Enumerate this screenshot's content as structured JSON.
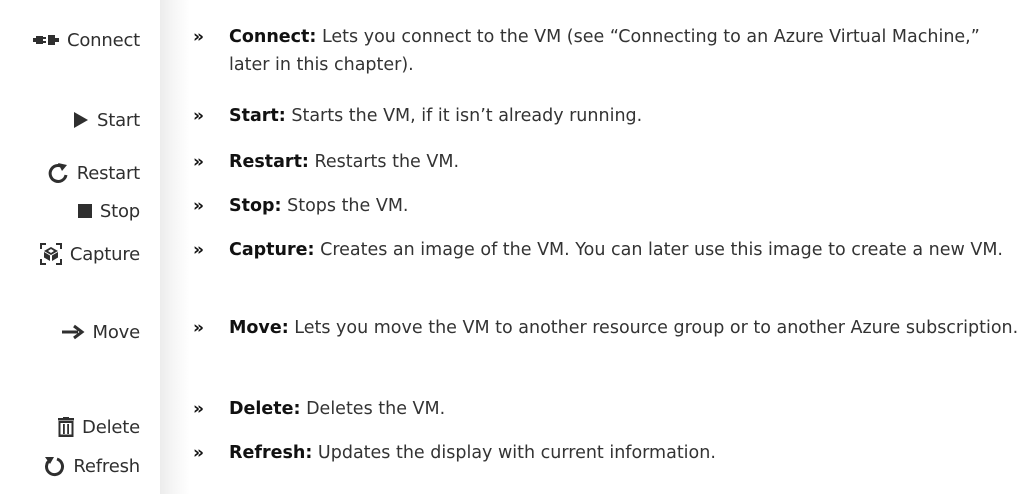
{
  "colors": {
    "text": "#333333",
    "icon": "#2f2f2f",
    "bullet": "#111111"
  },
  "bullet_glyph": "»",
  "items": [
    {
      "icon": "connect-icon",
      "button_label": "Connect",
      "term": "Connect:",
      "text": "Lets you connect to the VM (see “Connecting to an Azure Virtual Machine,” later in this chapter)."
    },
    {
      "icon": "play-icon",
      "button_label": "Start",
      "term": "Start:",
      "text": "Starts the VM, if it isn’t already running."
    },
    {
      "icon": "restart-icon",
      "button_label": "Restart",
      "term": "Restart:",
      "text": "Restarts the VM."
    },
    {
      "icon": "stop-icon",
      "button_label": "Stop",
      "term": "Stop:",
      "text": "Stops the VM."
    },
    {
      "icon": "capture-icon",
      "button_label": "Capture",
      "term": "Capture:",
      "text": "Creates an image of the VM. You can later use this image to create a new VM."
    },
    {
      "icon": "arrow-right-icon",
      "button_label": "Move",
      "term": "Move:",
      "text": "Lets you move the VM to another resource group or to another Azure subscription."
    },
    {
      "icon": "trash-icon",
      "button_label": "Delete",
      "term": "Delete:",
      "text": "Deletes the VM."
    },
    {
      "icon": "refresh-icon",
      "button_label": "Refresh",
      "term": "Refresh:",
      "text": "Updates the display with current information."
    }
  ]
}
